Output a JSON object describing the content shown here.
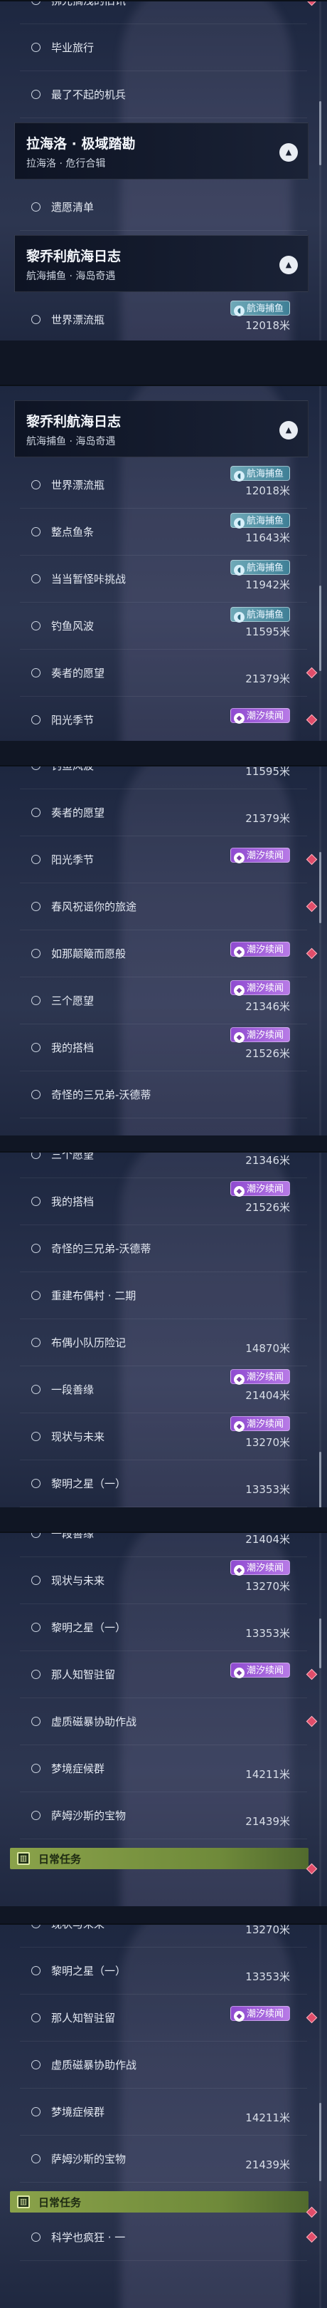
{
  "tide_badge": "潮汐续闻",
  "fish_badge": "航海捕鱼",
  "daily_tasks_label": "日常任务",
  "groups": {
    "lhl": {
      "title": "拉海洛 · 极域踏勘",
      "subtitle": "拉海洛 · 危行合辑"
    },
    "lqy": {
      "title": "黎乔利航海日志",
      "subtitle": "航海捕鱼 · 海岛奇遇"
    }
  },
  "quests": {
    "fugc": "拂光搁浅的旧讯",
    "bylx": "毕业旅行",
    "lbqdjb": "最了不起的机兵",
    "ydqd": "遗愿清单",
    "sjplp": "世界漂流瓶",
    "zdyt": "整点鱼条",
    "ddgltz": "当当暂怪咔挑战",
    "dyfb": "钓鱼风波",
    "zzdyw": "奏者的愿望",
    "ygjj": "阳光季节",
    "cfzwzdly": "春风祝谣你的旅途",
    "rnpclsb": "如那颠簸而愿般",
    "sgyw": "三个愿望",
    "wddd": "我的搭档",
    "qtdsxd": "奇怪的三兄弟-沃德蒂",
    "cjbot": "重建布偶村 · 二期",
    "bxxdlj": "布偶小队历险记",
    "yds": "一段善缘",
    "xzywl": "现状与未来",
    "lmzx": "黎明之星（一）",
    "nrzzzl": "那人知智驻留",
    "xzcjxt": "虚质磁暴协助作战",
    "mjzhq": "梦境症候群",
    "smsrdbw": "萨姆沙斯的宝物",
    "kxsfk": "科学也疯狂 · 一"
  },
  "distances": {
    "sjplp": "12018米",
    "zdyt": "11643米",
    "ddgltz": "11942米",
    "dyfb": "11595米",
    "zzdyw": "21379米",
    "sgyw": "21346米",
    "wddd": "21526米",
    "bxxdlj": "14870米",
    "yds": "21404米",
    "xzywl": "13270米",
    "lmzx": "13353米",
    "mjzhq": "14211米",
    "smsrdbw": "21439米"
  }
}
